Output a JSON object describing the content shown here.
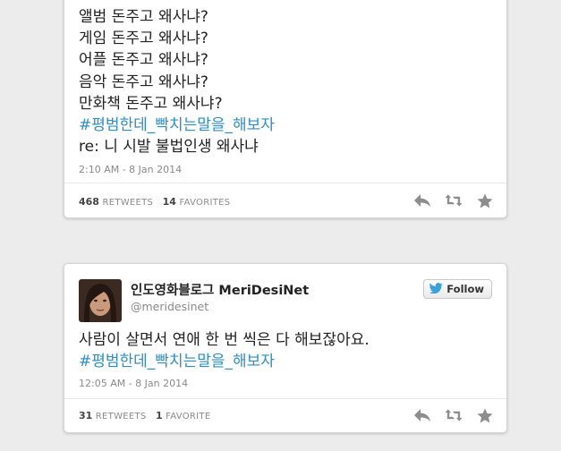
{
  "tweet1": {
    "lines": [
      "앨범 돈주고 왜사냐?",
      "게임 돈주고 왜사냐?",
      "어플 돈주고 왜사냐?",
      "음악 돈주고 왜사냐?",
      "만화책 돈주고 왜사냐?"
    ],
    "hashtag": "#평범한데_빡치는말을_해보자",
    "reply": "re: 니 시발 불법인생 왜사냐",
    "timestamp": "2:10 AM - 8 Jan 2014",
    "retweets_count": "468",
    "retweets_label": "RETWEETS",
    "favorites_count": "14",
    "favorites_label": "FAVORITES"
  },
  "tweet2": {
    "display_name": "인도영화블로그 MeriDesiNet",
    "handle": "@meridesinet",
    "follow_label": "Follow",
    "text": "사람이 살면서 연애 한 번 씩은 다 해보잖아요.",
    "hashtag": "#평범한데_빡치는말을_해보자",
    "timestamp": "12:05 AM - 8 Jan 2014",
    "retweets_count": "31",
    "retweets_label": "RETWEETS",
    "favorites_count": "1",
    "favorites_label": "FAVORITE"
  },
  "icons": [
    "reply-icon",
    "retweet-icon",
    "favorite-icon",
    "twitter-bird-icon"
  ],
  "colors": {
    "hashtag": "#2e8fc4",
    "meta": "#8a8a8a",
    "follow_bird": "#3aa1db"
  }
}
